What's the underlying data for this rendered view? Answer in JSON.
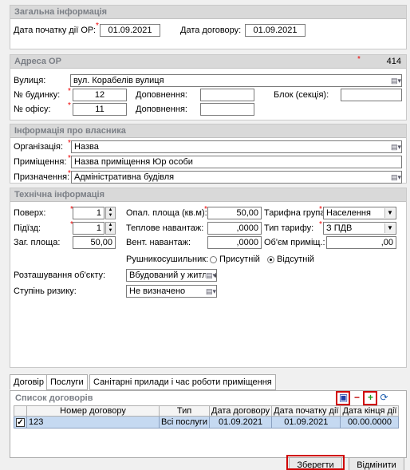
{
  "general": {
    "title": "Загальна інформація",
    "start_date_label": "Дата початку дії ОР:",
    "start_date_value": "01.09.2021",
    "contract_date_label": "Дата договору:",
    "contract_date_value": "01.09.2021"
  },
  "address": {
    "title": "Адреса ОР",
    "code": "414",
    "street_label": "Вулиця:",
    "street_value": "вул. Корабелів вулиця",
    "building_label": "№ будинку:",
    "building_value": "12",
    "extra1_label": "Доповнення:",
    "extra1_value": "",
    "block_label": "Блок (секція):",
    "block_value": "",
    "office_label": "№ офісу:",
    "office_value": "11",
    "extra2_label": "Доповнення:",
    "extra2_value": ""
  },
  "owner": {
    "title": "Інформація про власника",
    "org_label": "Організація:",
    "org_value": "Назва",
    "room_label": "Приміщення:",
    "room_value": "Назва приміщення Юр особи",
    "purpose_label": "Призначення:",
    "purpose_value": "Адміністративна будівля"
  },
  "tech": {
    "title": "Технічна інформація",
    "floor_label": "Поверх:",
    "floor_value": "1",
    "entrance_label": "Підїзд:",
    "entrance_value": "1",
    "total_area_label": "Заг. площа:",
    "total_area_value": "50,00",
    "heated_area_label": "Опал. площа (кв.м):",
    "heated_area_value": "50,00",
    "heat_load_label": "Теплове навантаж:",
    "heat_load_value": ",0000",
    "vent_load_label": "Вент. навантаж:",
    "vent_load_value": ",0000",
    "tariff_group_label": "Тарифна група:",
    "tariff_group_value": "Населення",
    "tariff_type_label": "Тип тарифу:",
    "tariff_type_value": "З ПДВ",
    "volume_label": "Об'єм приміщ.:",
    "volume_value": ",00",
    "towel_label": "Рушникосушильник:",
    "towel_present": "Присутній",
    "towel_absent": "Відсутній",
    "location_label": "Розташування об'єкту:",
    "location_value": "Вбудований у житловий будино",
    "risk_label": "Ступінь ризику:",
    "risk_value": "Не визначено"
  },
  "tabs": [
    "Договір",
    "Послуги",
    "Санітарні прилади і час роботи приміщення"
  ],
  "contracts": {
    "title": "Список договорів",
    "columns": [
      "Номер договору",
      "Тип",
      "Дата договору",
      "Дата початку дії",
      "Дата кінця дії"
    ],
    "rows": [
      {
        "number": "123",
        "type": "Всі послуги",
        "contract_date": "01.09.2021",
        "start_date": "01.09.2021",
        "end_date": "00.00.0000"
      }
    ]
  },
  "buttons": {
    "save": "Зберегти",
    "cancel": "Відмінити"
  },
  "colors": {
    "highlight": "#d00000",
    "group_title": "#7b7f86",
    "selected_row": "#c5d9f1",
    "required": "#e00000"
  },
  "icons": [
    "save-icon",
    "remove-icon",
    "add-icon",
    "refresh-icon",
    "dropdown-icon",
    "checkbox-icon"
  ]
}
